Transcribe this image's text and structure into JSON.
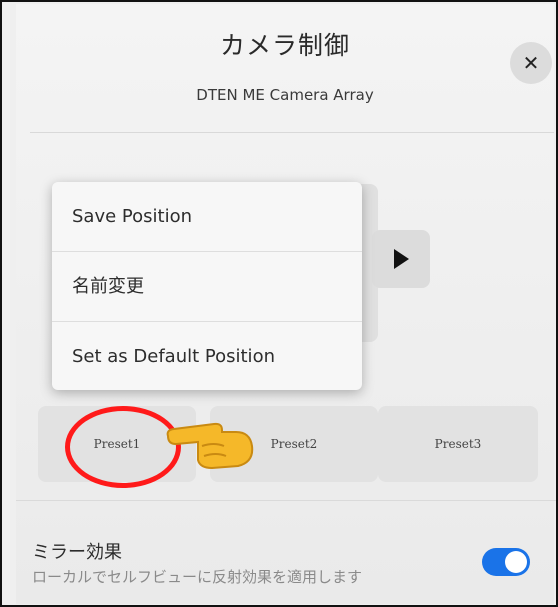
{
  "header": {
    "title": "カメラ制御",
    "subtitle": "DTEN ME Camera Array",
    "close_label": "✕"
  },
  "context_menu": {
    "items": [
      {
        "label": "Save Position"
      },
      {
        "label": "名前変更"
      },
      {
        "label": "Set as Default Position"
      }
    ]
  },
  "presets": [
    {
      "label": "Preset1"
    },
    {
      "label": "Preset2"
    },
    {
      "label": "Preset3"
    }
  ],
  "mirror_effect": {
    "title": "ミラー効果",
    "description": "ローカルでセルフビューに反射効果を適用します",
    "enabled": true
  },
  "annotations": {
    "highlight_color": "#ff1a1a",
    "pointer_icon": "pointing-hand-icon"
  },
  "colors": {
    "accent": "#1a73e8"
  }
}
